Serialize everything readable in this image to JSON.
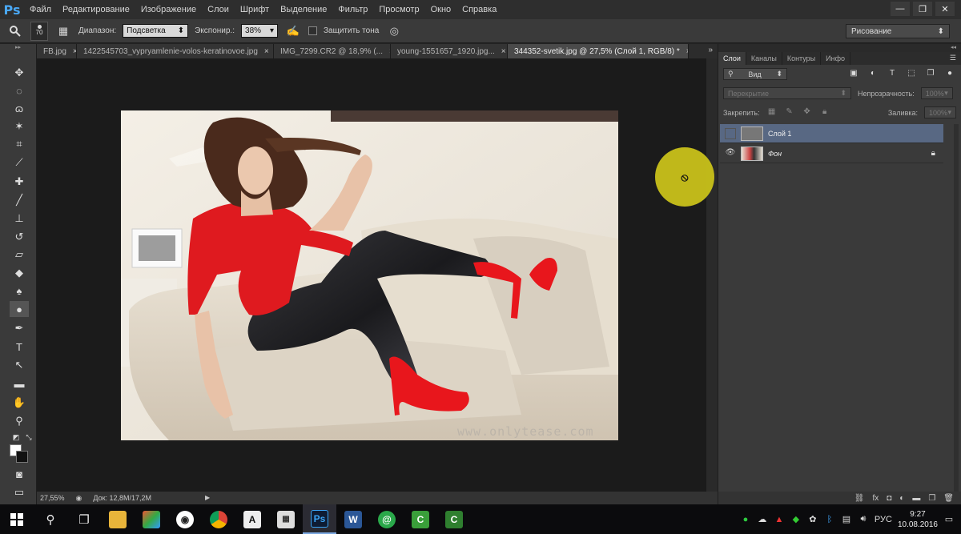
{
  "app": {
    "logo": "Ps"
  },
  "menu": [
    "Файл",
    "Редактирование",
    "Изображение",
    "Слои",
    "Шрифт",
    "Выделение",
    "Фильтр",
    "Просмотр",
    "Окно",
    "Справка"
  ],
  "window_controls": {
    "minimize": "—",
    "restore": "❐",
    "close": "✕"
  },
  "options": {
    "brush_size": "70",
    "range_label": "Диапазон:",
    "range_value": "Подсветка",
    "exposure_label": "Экспонир.:",
    "exposure_value": "38%",
    "protect_tones_label": "Защитить тона",
    "workspace": "Рисование"
  },
  "tabs": [
    {
      "label": "FB.jpg"
    },
    {
      "label": "1422545703_vypryamlenie-volos-keratinovoe.jpg"
    },
    {
      "label": "IMG_7299.CR2 @ 18,9% (..."
    },
    {
      "label": "young-1551657_1920.jpg..."
    },
    {
      "label": "344352-svetik.jpg @ 27,5% (Слой 1, RGB/8) *",
      "active": true
    }
  ],
  "tab_close": "×",
  "tabs_more": "»",
  "status": {
    "zoom": "27,55%",
    "doc": "Док: 12,8M/17,2M"
  },
  "image": {
    "watermark": "www.onlytease.com"
  },
  "panel": {
    "tabs": [
      "Слои",
      "Каналы",
      "Контуры",
      "Инфо"
    ],
    "filter_kind": "Вид",
    "blend_mode": "Перекрытие",
    "opacity_label": "Непрозрачность:",
    "opacity_value": "100%",
    "lock_label": "Закрепить:",
    "fill_label": "Заливка:",
    "fill_value": "100%",
    "layers": [
      {
        "name": "Слой 1",
        "selected": true,
        "visible": false
      },
      {
        "name": "Фон",
        "selected": false,
        "visible": true,
        "locked": true
      }
    ]
  },
  "taskbar": {
    "language": "РУС",
    "time": "9:27",
    "date": "10.08.2016"
  }
}
